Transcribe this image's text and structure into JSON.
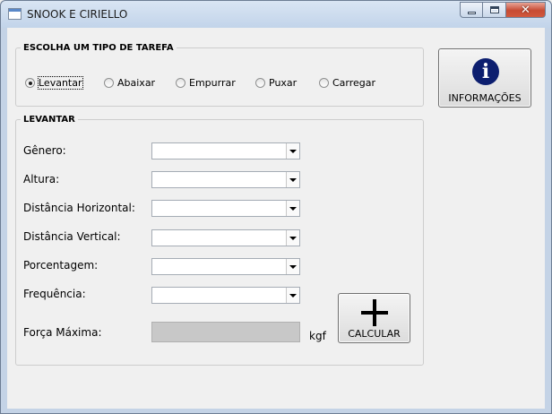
{
  "window": {
    "title": "SNOOK E CIRIELLO"
  },
  "task_group": {
    "legend": "ESCOLHA UM TIPO DE TAREFA",
    "options": [
      {
        "label": "Levantar",
        "checked": true
      },
      {
        "label": "Abaixar",
        "checked": false
      },
      {
        "label": "Empurrar",
        "checked": false
      },
      {
        "label": "Puxar",
        "checked": false
      },
      {
        "label": "Carregar",
        "checked": false
      }
    ]
  },
  "form_group": {
    "legend": "LEVANTAR",
    "fields": [
      {
        "label": "Gênero:",
        "value": ""
      },
      {
        "label": "Altura:",
        "value": ""
      },
      {
        "label": "Distância Horizontal:",
        "value": ""
      },
      {
        "label": "Distância Vertical:",
        "value": ""
      },
      {
        "label": "Porcentagem:",
        "value": ""
      },
      {
        "label": "Frequência:",
        "value": ""
      }
    ],
    "result": {
      "label": "Força Máxima:",
      "value": "",
      "unit": "kgf"
    }
  },
  "buttons": {
    "info_label": "INFORMAÇÕES",
    "info_icon": "info-icon",
    "calc_label": "CALCULAR",
    "calc_icon": "plus-icon"
  },
  "colors": {
    "info_icon_bg": "#0c1e6f",
    "close_button": "#c74a33"
  }
}
